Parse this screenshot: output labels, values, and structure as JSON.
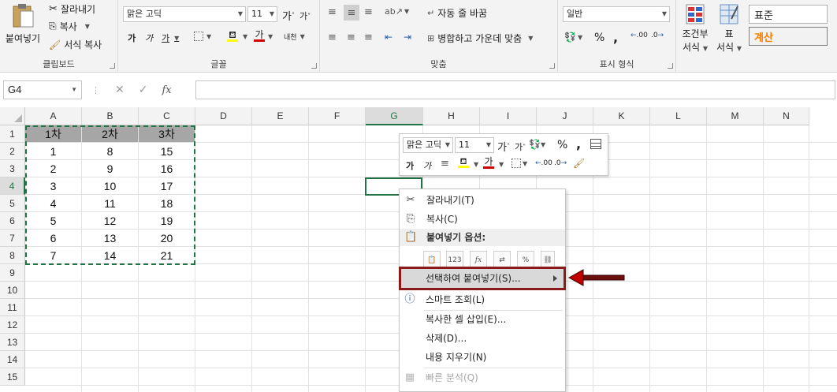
{
  "ribbon": {
    "clipboard": {
      "paste_label": "붙여넣기",
      "cut_label": "잘라내기",
      "copy_label": "복사",
      "format_painter_label": "서식 복사",
      "group_label": "클립보드"
    },
    "font": {
      "font_name": "맑은 고딕",
      "font_size": "11",
      "group_label": "글꼴",
      "bold_label": "가",
      "italic_label": "가",
      "underline_label": "가",
      "grow_label": "가",
      "shrink_label": "가",
      "font_color_label": "가",
      "phonetic_label": "내천"
    },
    "alignment": {
      "wrap_text_label": "자동 줄 바꿈",
      "merge_center_label": "병합하고 가운데 맞춤",
      "group_label": "맞춤"
    },
    "number": {
      "format_value": "일반",
      "percent_label": "%",
      "comma_label": ",",
      "increase_decimal_label": ".00",
      "decrease_decimal_label": ".0",
      "group_label": "표시 형식"
    },
    "styles": {
      "conditional_format_label_1": "조건부",
      "conditional_format_label_2": "서식",
      "table_format_label_1": "표",
      "table_format_label_2": "서식",
      "style_normal": "표준",
      "style_calc": "계산"
    }
  },
  "formula_bar": {
    "name_box": "G4",
    "fx_label": "fx",
    "value": ""
  },
  "grid": {
    "columns": [
      "A",
      "B",
      "C",
      "D",
      "E",
      "F",
      "G",
      "H",
      "I",
      "J",
      "K",
      "L",
      "M",
      "N"
    ],
    "rows": [
      "1",
      "2",
      "3",
      "4",
      "5",
      "6",
      "7",
      "8",
      "9",
      "10",
      "11",
      "12",
      "13",
      "14",
      "15"
    ],
    "selected_column": "G",
    "selected_row": "4",
    "header_row": [
      "1차",
      "2차",
      "3차"
    ],
    "data_rows": [
      [
        "1",
        "8",
        "15"
      ],
      [
        "2",
        "9",
        "16"
      ],
      [
        "3",
        "10",
        "17"
      ],
      [
        "4",
        "11",
        "18"
      ],
      [
        "5",
        "12",
        "19"
      ],
      [
        "6",
        "13",
        "20"
      ],
      [
        "7",
        "14",
        "21"
      ]
    ]
  },
  "mini_toolbar": {
    "font_name": "맑은 고딕",
    "font_size": "11",
    "percent_label": "%",
    "comma_label": ",",
    "bold_label": "가",
    "italic_label": "가",
    "font_color_label": "가",
    "increase_decimal_label": ".00",
    "decrease_decimal_label": ".0"
  },
  "context_menu": {
    "cut_label": "잘라내기(T)",
    "copy_label": "복사(C)",
    "paste_options_label": "붙여넣기 옵션:",
    "paste_special_label": "선택하여 붙여넣기(S)...",
    "smart_lookup_label": "스마트 조회(L)",
    "insert_copied_label": "복사한 셀 삽입(E)...",
    "delete_label": "삭제(D)...",
    "clear_contents_label": "내용 지우기(N)",
    "quick_analysis_label": "빠른 분석(Q)"
  },
  "colors": {
    "accent": "#217346",
    "highlight_border": "#8b1a1a",
    "header_fill": "#a6a6a6"
  }
}
